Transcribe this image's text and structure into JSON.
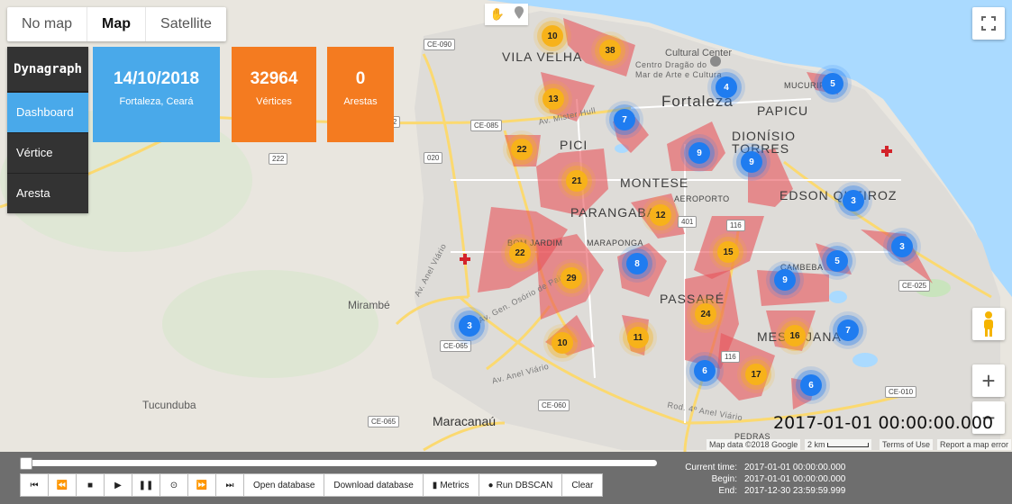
{
  "map_type": {
    "options": [
      "No map",
      "Map",
      "Satellite"
    ],
    "selected": "Map"
  },
  "map_labels": {
    "vila_velha": "VILA VELHA",
    "fortaleza": "Fortaleza",
    "papicu": "PAPICU",
    "mucuripe": "MUCURIPE",
    "cultural_center": "Cultural Center",
    "cultural_center_sub1": "Centro Dragão do",
    "cultural_center_sub2": "Mar de Arte e Cultura",
    "pici": "PICI",
    "montese": "MONTESE",
    "dionisio_torres_1": "DIONÍSIO",
    "dionisio_torres_2": "TORRES",
    "edson_queiroz": "EDSON QUEIROZ",
    "parangaba": "PARANGABA",
    "aeroporto": "AEROPORTO",
    "bom_jardim": "BOM JARDIM",
    "maraponga": "MARAPONGA",
    "cambeba": "CAMBEBA",
    "passare": "PASSARÉ",
    "messejana": "MESSEJANA",
    "mirambe": "Mirambé",
    "tucunduba": "Tucunduba",
    "maracanau": "Maracanaú",
    "pedras": "PEDRAS",
    "av_mister_hull": "Av. Mister Hull",
    "av_anel_viario_1": "Av. Anel Viário",
    "av_anel_viario_2": "Av. Anel Viário",
    "av_gen_osorio": "Av. Gen. Osório de Paiva",
    "rod_4_anel": "Rod. 4º Anel Viário",
    "shields": [
      "CE-090",
      "CE-085",
      "222",
      "020",
      "222",
      "401",
      "116",
      "116",
      "CE-025",
      "CE-065",
      "CE-060",
      "CE-065",
      "CE-010",
      "CE-025"
    ]
  },
  "clusters": [
    {
      "count": "10",
      "color": "yellow"
    },
    {
      "count": "38",
      "color": "yellow"
    },
    {
      "count": "13",
      "color": "yellow"
    },
    {
      "count": "4",
      "color": "blue"
    },
    {
      "count": "5",
      "color": "blue"
    },
    {
      "count": "7",
      "color": "blue"
    },
    {
      "count": "22",
      "color": "yellow"
    },
    {
      "count": "9",
      "color": "blue"
    },
    {
      "count": "9",
      "color": "blue"
    },
    {
      "count": "21",
      "color": "yellow"
    },
    {
      "count": "3",
      "color": "blue"
    },
    {
      "count": "12",
      "color": "yellow"
    },
    {
      "count": "3",
      "color": "blue"
    },
    {
      "count": "22",
      "color": "yellow"
    },
    {
      "count": "15",
      "color": "yellow"
    },
    {
      "count": "5",
      "color": "blue"
    },
    {
      "count": "8",
      "color": "blue"
    },
    {
      "count": "29",
      "color": "yellow"
    },
    {
      "count": "9",
      "color": "blue"
    },
    {
      "count": "3",
      "color": "blue"
    },
    {
      "count": "24",
      "color": "yellow"
    },
    {
      "count": "16",
      "color": "yellow"
    },
    {
      "count": "7",
      "color": "blue"
    },
    {
      "count": "10",
      "color": "yellow"
    },
    {
      "count": "11",
      "color": "yellow"
    },
    {
      "count": "6",
      "color": "blue"
    },
    {
      "count": "17",
      "color": "yellow"
    },
    {
      "count": "6",
      "color": "blue"
    }
  ],
  "sidebar": {
    "logo": "Dynagraph",
    "items": [
      {
        "label": "Dashboard",
        "active": true
      },
      {
        "label": "Vértice",
        "active": false
      },
      {
        "label": "Aresta",
        "active": false
      }
    ]
  },
  "tiles": {
    "date": {
      "value": "14/10/2018",
      "label": "Fortaleza, Ceará",
      "color": "#49a9ea"
    },
    "vertices": {
      "value": "32964",
      "label": "Vértices",
      "color": "#f47b20"
    },
    "edges": {
      "value": "0",
      "label": "Arestas",
      "color": "#f47b20"
    }
  },
  "map_timestamp": "2017-01-01 00:00:00.000",
  "attribution": {
    "map_data": "Map data ©2018 Google",
    "scale": "2 km",
    "terms": "Terms of Use",
    "report": "Report a map error"
  },
  "controls": {
    "open_db": "Open database",
    "download_db": "Download database",
    "metrics": "Metrics",
    "run_dbscan": "Run DBSCAN",
    "clear": "Clear"
  },
  "times": {
    "current_label": "Current time:",
    "current_value": "2017-01-01 00:00:00.000",
    "begin_label": "Begin:",
    "begin_value": "2017-01-01 00:00:00.000",
    "end_label": "End:",
    "end_value": "2017-12-30 23:59:59.999"
  },
  "colors": {
    "cluster_yellow": "#f7b21a",
    "cluster_blue": "#1f7cf0",
    "hull": "#e8545a",
    "sidebar": "#333333",
    "bottom_bar": "#6e6e6e"
  }
}
